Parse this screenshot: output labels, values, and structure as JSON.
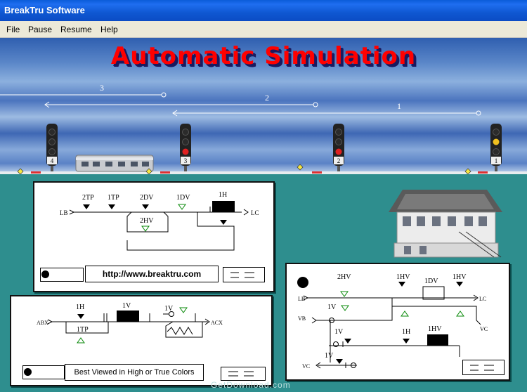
{
  "window": {
    "title": "BreakTru Software"
  },
  "menu": [
    "File",
    "Pause",
    "Resume",
    "Help"
  ],
  "banner": {
    "title": "Automatic Simulation"
  },
  "tracks": {
    "route_labels": [
      "3",
      "2",
      "1"
    ]
  },
  "signals": [
    {
      "number": "4",
      "aspect": "dark"
    },
    {
      "number": "3",
      "aspect": "red"
    },
    {
      "number": "2",
      "aspect": "red"
    },
    {
      "number": "1",
      "aspect": "yellow"
    }
  ],
  "panel_top": {
    "labels": [
      "2TP",
      "1TP",
      "2DV",
      "1DV",
      "1H",
      "2HV",
      "LB",
      "LC"
    ],
    "url": "http://www.breaktru.com"
  },
  "panel_bottom_left": {
    "labels": [
      "1H",
      "1V",
      "1V",
      "1TP",
      "ABX",
      "ACX"
    ],
    "note": "Best Viewed in High or True Colors"
  },
  "panel_right": {
    "labels": [
      "2HV",
      "1HV",
      "1DV",
      "1HV",
      "1V",
      "1V",
      "1H",
      "1HV",
      "1V",
      "LB",
      "VB",
      "LC",
      "VC",
      "VC"
    ]
  },
  "colors": {
    "teal": "#2e8e8e",
    "title_red": "#ff0000",
    "xp_blue": "#0b4cc4"
  },
  "watermark": "GetDownload.com"
}
